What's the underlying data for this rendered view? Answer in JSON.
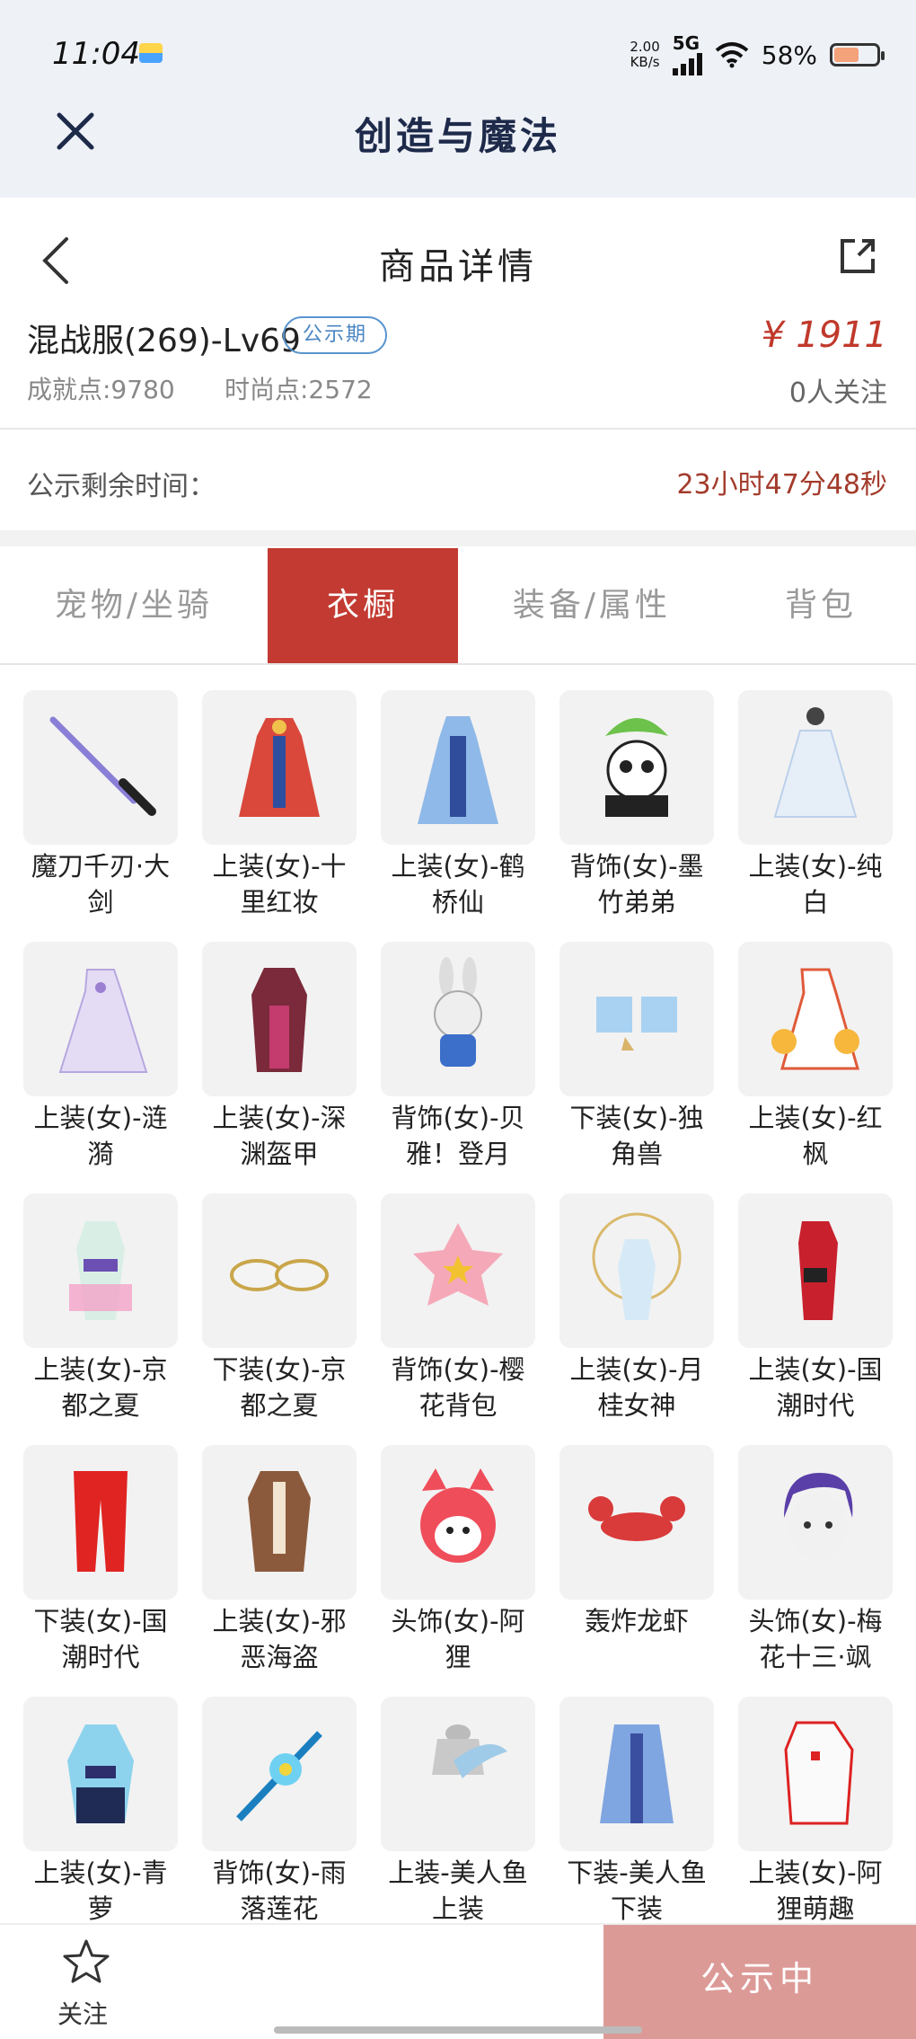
{
  "status": {
    "time": "11:04",
    "speed_top": "2.00",
    "speed_bottom": "KB/s",
    "network": "5G",
    "battery": "58%",
    "battery_level": 0.58
  },
  "app": {
    "title": "创造与魔法"
  },
  "nav": {
    "title": "商品详情"
  },
  "product": {
    "name": "混战服(269)-Lv69",
    "badge": "公示期",
    "price": "¥ 1911",
    "achievement": "成就点:9780",
    "fashion": "时尚点:2572",
    "followers": "0人关注",
    "remaining_label": "公示剩余时间：",
    "remaining_value": "23小时47分48秒"
  },
  "tabs": [
    {
      "label": "宠物/坐骑"
    },
    {
      "label": "衣橱"
    },
    {
      "label": "装备/属性"
    },
    {
      "label": "背包"
    }
  ],
  "active_tab": 1,
  "items": [
    {
      "name": "魔刀千刃·大剑",
      "icon": "sword-icon"
    },
    {
      "name": "上装(女)-十里红妆",
      "icon": "red-dress-icon"
    },
    {
      "name": "上装(女)-鹤桥仙",
      "icon": "blue-dress-icon"
    },
    {
      "name": "背饰(女)-墨竹弟弟",
      "icon": "panda-icon"
    },
    {
      "name": "上装(女)-纯白",
      "icon": "white-dress-icon"
    },
    {
      "name": "上装(女)-涟漪",
      "icon": "lilac-dress-icon"
    },
    {
      "name": "上装(女)-深渊盔甲",
      "icon": "armor-icon"
    },
    {
      "name": "背饰(女)-贝雅！登月",
      "icon": "rabbit-icon"
    },
    {
      "name": "下装(女)-独角兽",
      "icon": "boots-icon"
    },
    {
      "name": "上装(女)-红枫",
      "icon": "maple-dress-icon"
    },
    {
      "name": "上装(女)-京都之夏",
      "icon": "kimono-icon"
    },
    {
      "name": "下装(女)-京都之夏",
      "icon": "sandals-icon"
    },
    {
      "name": "背饰(女)-樱花背包",
      "icon": "sakura-bag-icon"
    },
    {
      "name": "上装(女)-月桂女神",
      "icon": "laurel-dress-icon"
    },
    {
      "name": "上装(女)-国潮时代",
      "icon": "qipao-icon"
    },
    {
      "name": "下装(女)-国潮时代",
      "icon": "red-pants-icon"
    },
    {
      "name": "上装(女)-邪恶海盗",
      "icon": "pirate-vest-icon"
    },
    {
      "name": "头饰(女)-阿狸",
      "icon": "ali-head-icon"
    },
    {
      "name": "轰炸龙虾",
      "icon": "lobster-icon"
    },
    {
      "name": "头饰(女)-梅花十三·飒",
      "icon": "purple-hair-icon"
    },
    {
      "name": "上装(女)-青萝",
      "icon": "cyan-kimono-icon"
    },
    {
      "name": "背饰(女)-雨落莲花",
      "icon": "lotus-staff-icon"
    },
    {
      "name": "上装-美人鱼上装",
      "icon": "mermaid-top-icon"
    },
    {
      "name": "下装-美人鱼下装",
      "icon": "mermaid-skirt-icon"
    },
    {
      "name": "上装(女)-阿狸萌趣",
      "icon": "hoodie-icon"
    }
  ],
  "bottom": {
    "follow_label": "关注",
    "notice_button": "公示中"
  },
  "colors": {
    "accent": "#c23a31",
    "price": "#c0392b",
    "badge": "#4a86c2",
    "notice_button": "#dc9a97"
  }
}
